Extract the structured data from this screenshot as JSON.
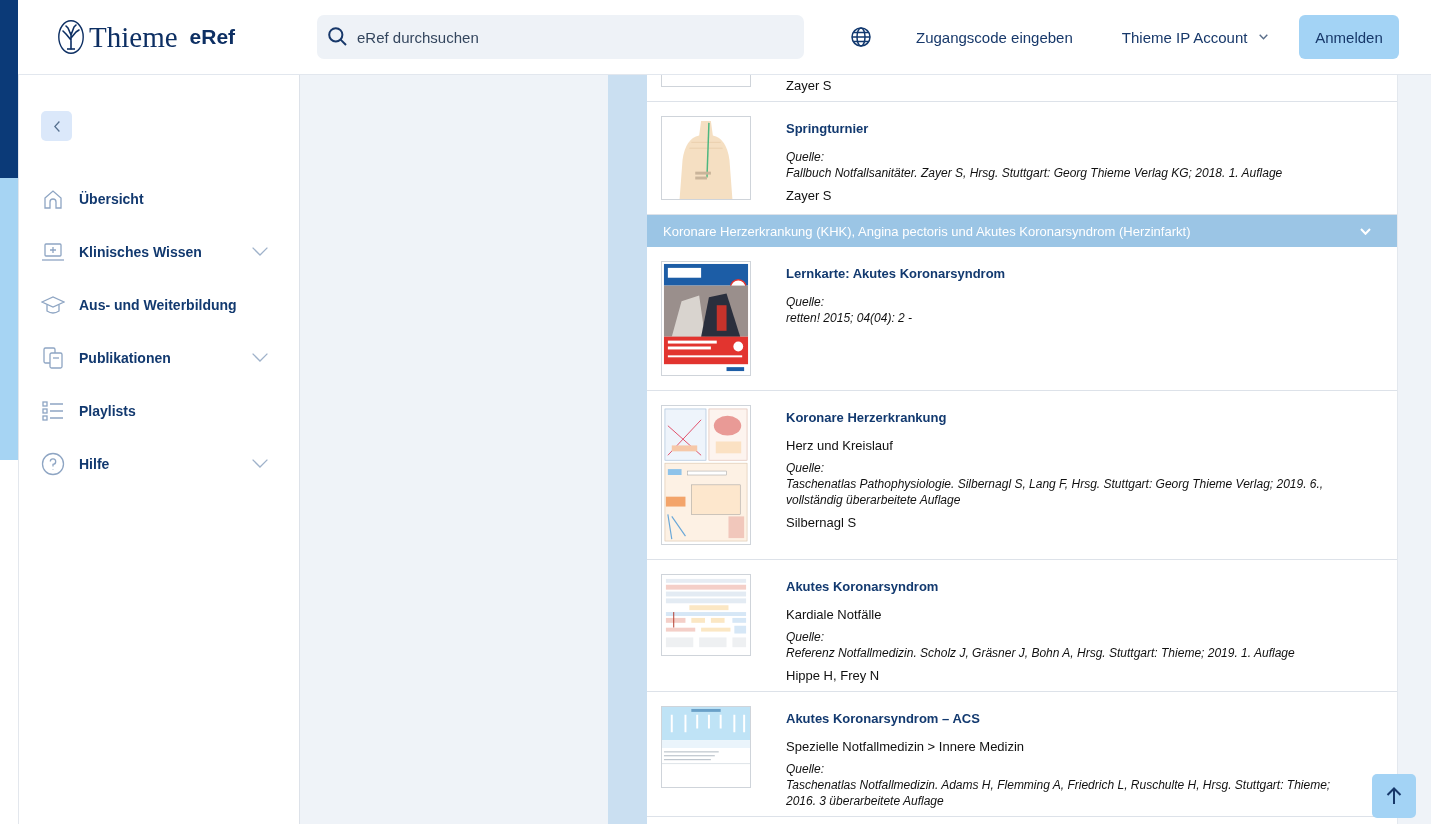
{
  "header": {
    "logo": {
      "brand": "Thieme",
      "product": "eRef"
    },
    "search": {
      "placeholder": "eRef durchsuchen"
    },
    "nav": [
      {
        "kind": "link",
        "label": "Zugangscode eingeben"
      },
      {
        "kind": "dropdown",
        "label": "Thieme IP Account"
      }
    ],
    "login_button": "Anmelden"
  },
  "sidebar": {
    "items": [
      {
        "label": "Übersicht",
        "expandable": false
      },
      {
        "label": "Klinisches Wissen",
        "expandable": true
      },
      {
        "label": "Aus- und Weiterbildung",
        "expandable": false
      },
      {
        "label": "Publikationen",
        "expandable": true
      },
      {
        "label": "Playlists",
        "expandable": false
      },
      {
        "label": "Hilfe",
        "expandable": true
      }
    ]
  },
  "results": [
    {
      "kind": "entry_tail",
      "authors": "Zayer S"
    },
    {
      "kind": "entry",
      "title": "Springturnier",
      "source_label": "Quelle:",
      "source": "Fallbuch Notfallsanitäter. Zayer S, Hrsg. Stuttgart: Georg Thieme Verlag KG; 2018. 1. Auflage",
      "authors": "Zayer S"
    },
    {
      "kind": "group_header",
      "label": "Koronare Herzerkrankung (KHK), Angina pectoris und Akutes Koronarsyndrom (Herzinfarkt)",
      "expanded": true
    },
    {
      "kind": "entry",
      "title": "Lernkarte: Akutes Koronarsyndrom",
      "source_label": "Quelle:",
      "source": "retten! 2015; 04(04): 2 -"
    },
    {
      "kind": "entry",
      "title": "Koronare Herzerkrankung",
      "category": "Herz und Kreislauf",
      "source_label": "Quelle:",
      "source": "Taschenatlas Pathophysiologie. Silbernagl S, Lang F, Hrsg. Stuttgart: Georg Thieme Verlag; 2019. 6., vollständig überarbeitete Auflage",
      "authors": "Silbernagl S"
    },
    {
      "kind": "entry",
      "title": "Akutes Koronarsyndrom",
      "category": "Kardiale Notfälle",
      "source_label": "Quelle:",
      "source": "Referenz Notfallmedizin. Scholz J, Gräsner J, Bohn A, Hrsg. Stuttgart: Thieme; 2019. 1. Auflage",
      "authors": "Hippe H, Frey N"
    },
    {
      "kind": "entry",
      "title": "Akutes Koronarsyndrom – ACS",
      "category": "Spezielle Notfallmedizin > Innere Medizin",
      "source_label": "Quelle:",
      "source": "Taschenatlas Notfallmedizin. Adams H, Flemming A, Friedrich L, Ruschulte H, Hrsg. Stuttgart: Thieme; 2016. 3 überarbeitete Auflage"
    }
  ]
}
